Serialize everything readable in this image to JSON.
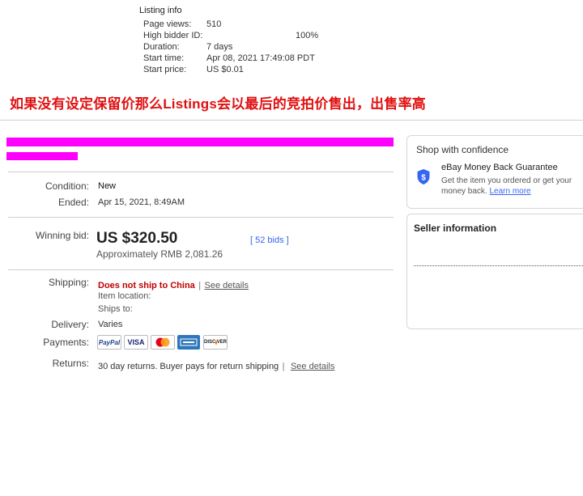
{
  "listing_info": {
    "title": "Listing info",
    "rows": [
      {
        "label": "Page views:",
        "value": "510"
      },
      {
        "label": "High bidder ID:",
        "value": "",
        "extra": "100%"
      },
      {
        "label": "Duration:",
        "value": "7 days"
      },
      {
        "label": "Start time:",
        "value": "Apr 08, 2021 17:49:08 PDT"
      },
      {
        "label": "Start price:",
        "value": "US $0.01"
      }
    ]
  },
  "annotation": "如果没有设定保留价那么Listings会以最后的竞拍价售出，出售率高",
  "item": {
    "condition_label": "Condition:",
    "condition_value": "New",
    "ended_label": "Ended:",
    "ended_value": "Apr 15, 2021, 8:49AM",
    "winning_label": "Winning bid:",
    "winning_value": "US $320.50",
    "bids_text": "52 bids",
    "approx": "Approximately RMB 2,081.26",
    "shipping_label": "Shipping:",
    "shipping_warning": "Does not ship to China",
    "shipping_sep": "|",
    "shipping_link": "See details",
    "item_location": "Item location:",
    "ships_to": "Ships to:",
    "delivery_label": "Delivery:",
    "delivery_value": "Varies",
    "payments_label": "Payments:",
    "payments": [
      "PayPal",
      "VISA",
      "Mastercard",
      "American Express",
      "Discover"
    ],
    "returns_label": "Returns:",
    "returns_text": "30 day returns. Buyer pays for return shipping",
    "returns_sep": "|",
    "returns_link": "See details"
  },
  "confidence": {
    "title": "Shop with confidence",
    "guarantee_title": "eBay Money Back Guarantee",
    "guarantee_text": "Get the item you ordered or get your money back.",
    "learn_more": "Learn more"
  },
  "seller": {
    "title": "Seller information"
  },
  "colors": {
    "accent_link": "#3665f3",
    "warning_red": "#c00000",
    "annotation_red": "#e01010",
    "redaction": "#ff00ff"
  }
}
